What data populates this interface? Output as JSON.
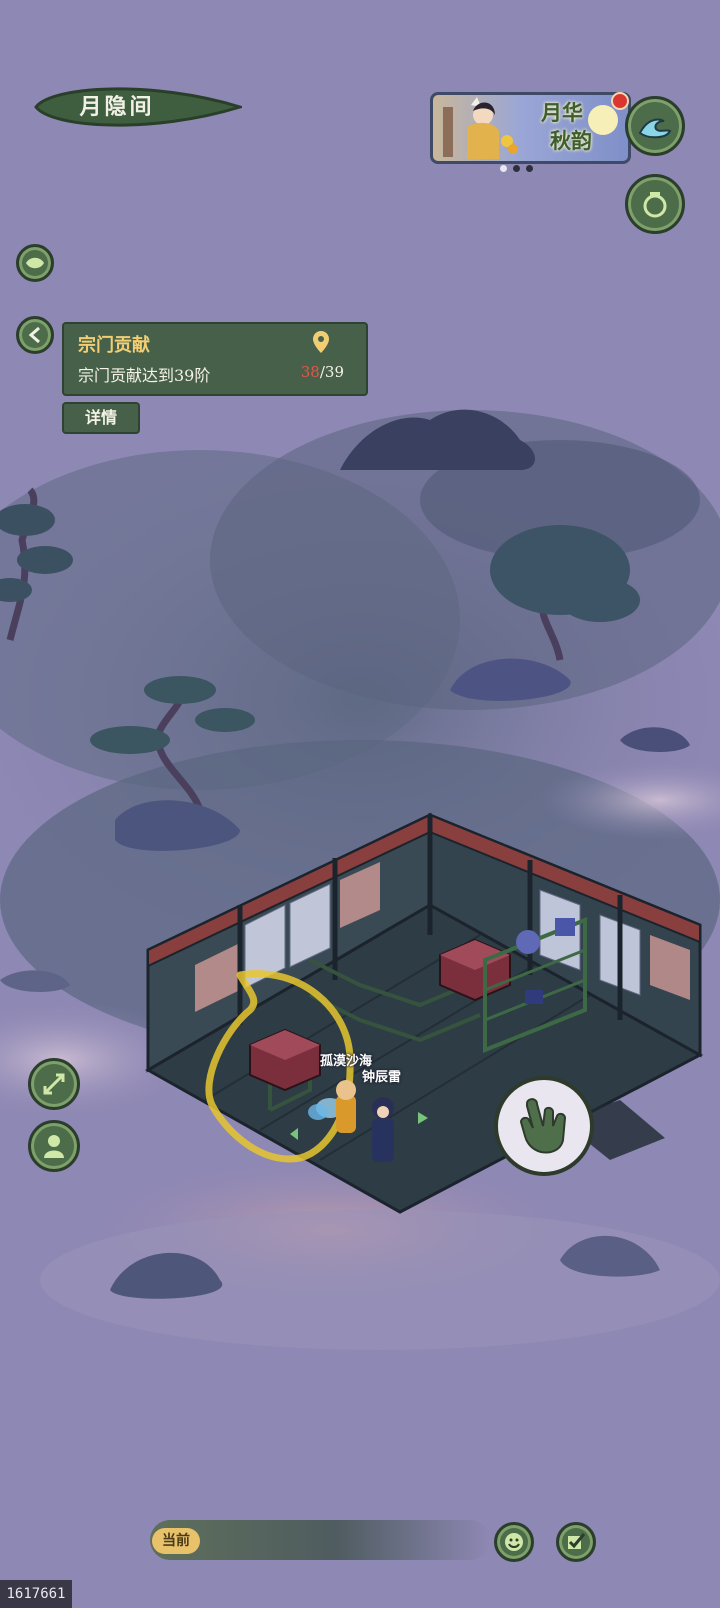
{
  "location": {
    "title": "月隐间"
  },
  "event_banner": {
    "line1": "月华",
    "line2": "秋韵"
  },
  "task": {
    "title": "宗门贡献",
    "description": "宗门贡献达到39阶",
    "progress_current": "38",
    "progress_total": "/39",
    "details_label": "详情"
  },
  "characters": [
    {
      "name": "孤漠沙海"
    },
    {
      "name": "钟辰雷"
    }
  ],
  "chat": {
    "channel_label": "当前"
  },
  "watermark": "1617661",
  "icons": {
    "top_right_1": "wave-icon",
    "top_right_2": "jar-icon",
    "left_collapse": "leaf-icon",
    "task_back": "chevron-left-icon",
    "task_locate": "location-pin-icon",
    "expand": "expand-arrows-icon",
    "avatar": "character-icon",
    "interact": "hand-pointer-icon",
    "emoji": "smile-icon",
    "check": "checkbox-pen-icon"
  },
  "colors": {
    "background": "#8e88b4",
    "button_green": "#4d6d4a",
    "task_title": "#f1ce74",
    "progress_current": "#e0584a"
  },
  "banner_pages": {
    "count": 3,
    "active": 1
  }
}
